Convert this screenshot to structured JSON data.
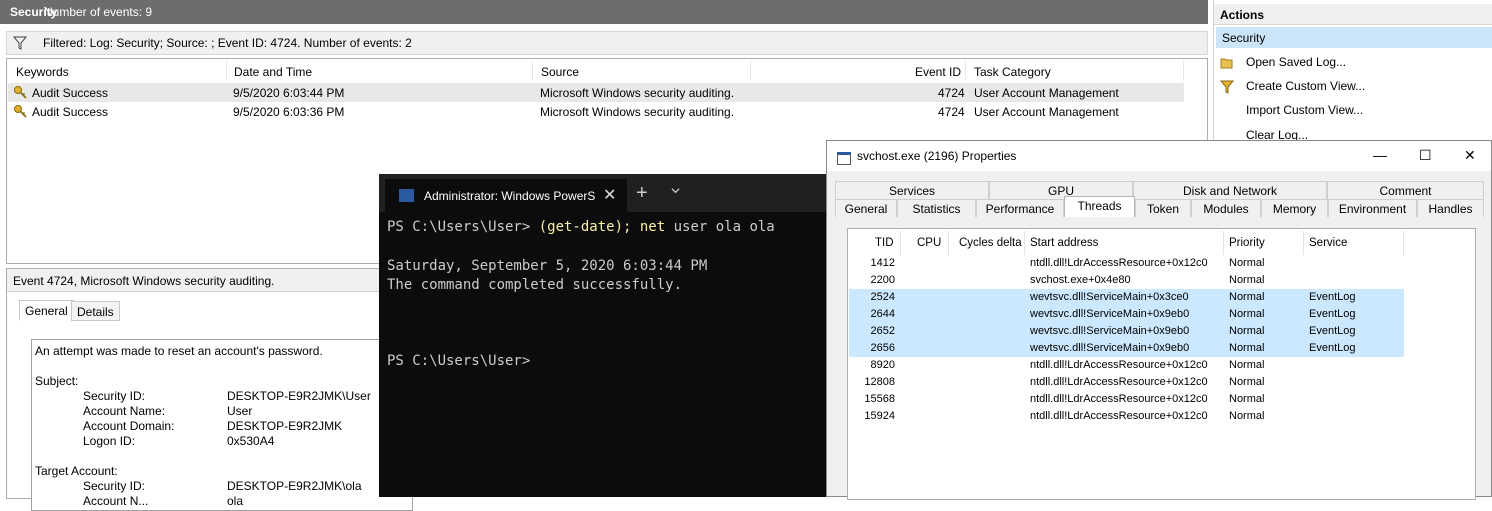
{
  "event_viewer": {
    "header_title": "Security",
    "header_count": "Number of events: 9",
    "filter_text": "Filtered: Log: Security; Source: ; Event ID: 4724. Number of events: 2",
    "columns": [
      "Keywords",
      "Date and Time",
      "Source",
      "Event ID",
      "Task Category"
    ],
    "rows": [
      {
        "keywords": "Audit Success",
        "date": "9/5/2020 6:03:44 PM",
        "source": "Microsoft Windows security auditing.",
        "event_id": "4724",
        "task": "User Account Management"
      },
      {
        "keywords": "Audit Success",
        "date": "9/5/2020 6:03:36 PM",
        "source": "Microsoft Windows security auditing.",
        "event_id": "4724",
        "task": "User Account Management"
      }
    ],
    "detail_title": "Event 4724, Microsoft Windows security auditing.",
    "detail_tabs": [
      "General",
      "Details"
    ],
    "detail": {
      "message": "An attempt was made to reset an account's password.",
      "subject_label": "Subject:",
      "security_id_label": "Security ID:",
      "security_id": "DESKTOP-E9R2JMK\\User",
      "account_name_label": "Account Name:",
      "account_name": "User",
      "account_domain_label": "Account Domain:",
      "account_domain": "DESKTOP-E9R2JMK",
      "logon_id_label": "Logon ID:",
      "logon_id": "0x530A4",
      "target_label": "Target Account:",
      "target_security_id_label": "Security ID:",
      "target_security_id": "DESKTOP-E9R2JMK\\ola",
      "target_account_name_label": "Account N...",
      "target_account_name": "ola"
    }
  },
  "actions": {
    "header": "Actions",
    "section": "Security",
    "items": [
      "Open Saved Log...",
      "Create Custom View...",
      "Import Custom View...",
      "Clear Log..."
    ]
  },
  "terminal": {
    "tab_title": "Administrator: Windows PowerShell",
    "line1_prompt": "PS C:\\Users\\User> ",
    "line1_cmd": "(get-date); net",
    "line1_args": " user ola ola",
    "line2": "Saturday, September 5, 2020 6:03:44 PM",
    "line3": "The command completed successfully.",
    "line4": "PS C:\\Users\\User>"
  },
  "properties": {
    "title": "svchost.exe (2196) Properties",
    "tabs_row1": [
      "Services",
      "GPU",
      "Disk and Network",
      "Comment"
    ],
    "tabs_row2": [
      "General",
      "Statistics",
      "Performance",
      "Threads",
      "Token",
      "Modules",
      "Memory",
      "Environment",
      "Handles"
    ],
    "active_tab": "Threads",
    "columns": [
      "TID",
      "CPU",
      "Cycles delta",
      "Start address",
      "Priority",
      "Service"
    ],
    "threads": [
      {
        "tid": "1412",
        "start": "ntdll.dll!LdrAccessResource+0x12c0",
        "priority": "Normal",
        "service": ""
      },
      {
        "tid": "2200",
        "start": "svchost.exe+0x4e80",
        "priority": "Normal",
        "service": ""
      },
      {
        "tid": "2524",
        "start": "wevtsvc.dll!ServiceMain+0x3ce0",
        "priority": "Normal",
        "service": "EventLog"
      },
      {
        "tid": "2644",
        "start": "wevtsvc.dll!ServiceMain+0x9eb0",
        "priority": "Normal",
        "service": "EventLog"
      },
      {
        "tid": "2652",
        "start": "wevtsvc.dll!ServiceMain+0x9eb0",
        "priority": "Normal",
        "service": "EventLog"
      },
      {
        "tid": "2656",
        "start": "wevtsvc.dll!ServiceMain+0x9eb0",
        "priority": "Normal",
        "service": "EventLog"
      },
      {
        "tid": "8920",
        "start": "ntdll.dll!LdrAccessResource+0x12c0",
        "priority": "Normal",
        "service": ""
      },
      {
        "tid": "12808",
        "start": "ntdll.dll!LdrAccessResource+0x12c0",
        "priority": "Normal",
        "service": ""
      },
      {
        "tid": "15568",
        "start": "ntdll.dll!LdrAccessResource+0x12c0",
        "priority": "Normal",
        "service": ""
      },
      {
        "tid": "15924",
        "start": "ntdll.dll!LdrAccessResource+0x12c0",
        "priority": "Normal",
        "service": ""
      }
    ]
  }
}
